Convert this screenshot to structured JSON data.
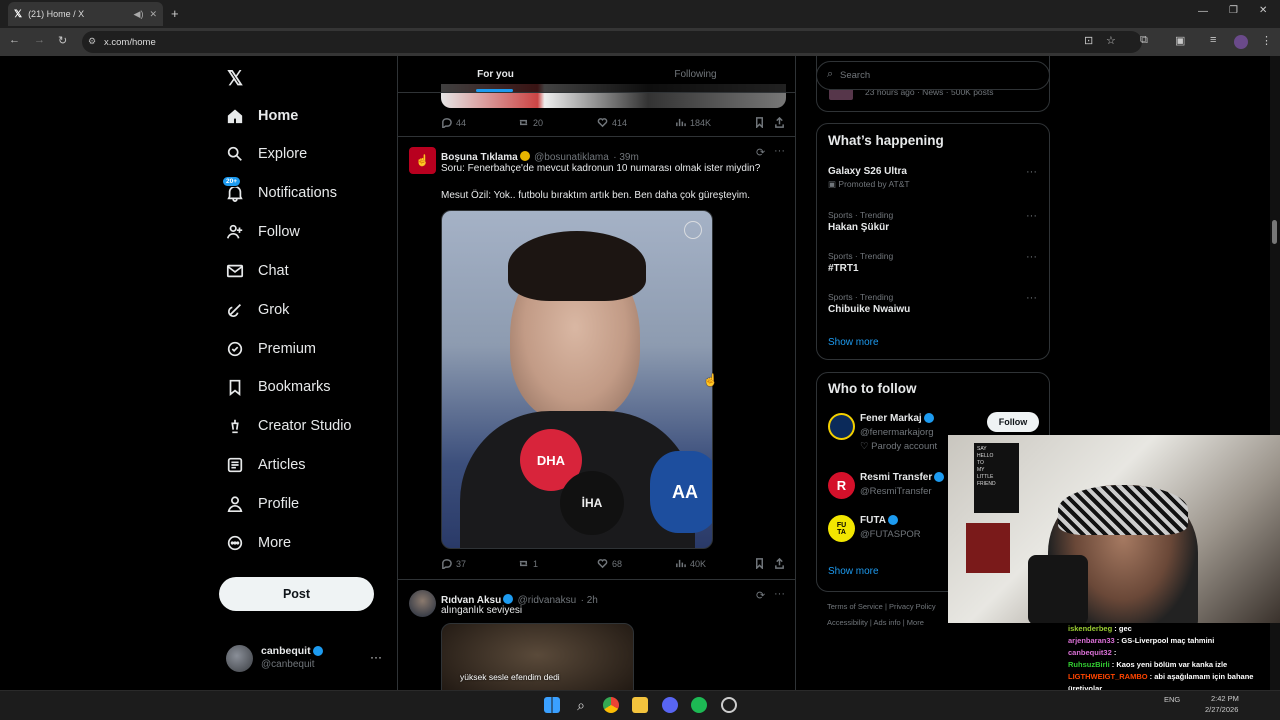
{
  "browser": {
    "tab_title": "(21) Home / X",
    "url": "x.com/home"
  },
  "sidebar": {
    "items": [
      {
        "label": "Home",
        "icon": "home-icon"
      },
      {
        "label": "Explore",
        "icon": "search-icon"
      },
      {
        "label": "Notifications",
        "icon": "bell-icon",
        "badge": "20+"
      },
      {
        "label": "Follow",
        "icon": "person-plus-icon"
      },
      {
        "label": "Chat",
        "icon": "mail-icon"
      },
      {
        "label": "Grok",
        "icon": "grok-icon"
      },
      {
        "label": "Premium",
        "icon": "premium-icon"
      },
      {
        "label": "Bookmarks",
        "icon": "bookmark-icon"
      },
      {
        "label": "Creator Studio",
        "icon": "creator-icon"
      },
      {
        "label": "Articles",
        "icon": "articles-icon"
      },
      {
        "label": "Profile",
        "icon": "profile-icon"
      },
      {
        "label": "More",
        "icon": "more-icon"
      }
    ],
    "post_label": "Post",
    "account": {
      "name": "canbequit",
      "handle": "@canbequit"
    }
  },
  "feed": {
    "tabs": [
      "For you",
      "Following"
    ],
    "top_actions": {
      "replies": "44",
      "reposts": "20",
      "likes": "414",
      "views": "184K"
    },
    "tweets": [
      {
        "name": "Boşuna Tıklama",
        "handle": "@bosunatiklama",
        "time": "· 39m",
        "text1": "Soru: Fenerbahçe'de mevcut kadronun 10 numarası olmak ister miydin?",
        "text2": "Mesut Özil: Yok.. futbolu bıraktım artık ben. Ben daha çok güreşteyim.",
        "replies": "37",
        "reposts": "1",
        "likes": "68",
        "views": "40K"
      },
      {
        "name": "Rıdvan Aksu",
        "handle": "@ridvanaksu",
        "time": "· 2h",
        "text1": "alınganlık seviyesi",
        "caption": "yüksek sesle efendim dedi"
      }
    ]
  },
  "right": {
    "search_placeholder": "Search",
    "top_meta": "23 hours ago · News · 500K posts",
    "whats_happening": {
      "title": "What’s happening",
      "items": [
        {
          "meta": "Promoted by AT&T",
          "name": "Galaxy S26 Ultra"
        },
        {
          "meta": "Sports · Trending",
          "name": "Hakan Şükür"
        },
        {
          "meta": "Sports · Trending",
          "name": "#TRT1"
        },
        {
          "meta": "Sports · Trending",
          "name": "Chibuike Nwaiwu"
        }
      ],
      "show_more": "Show more"
    },
    "who_to_follow": {
      "title": "Who to follow",
      "accounts": [
        {
          "name": "Fener Markaj",
          "handle": "@fenermarkajorg",
          "note": "Parody account",
          "button": "Follow"
        },
        {
          "name": "Resmi Transfer",
          "handle": "@ResmiTransfer"
        },
        {
          "name": "FUTA",
          "handle": "@FUTASPOR"
        }
      ],
      "show_more": "Show more"
    },
    "footer": [
      "Terms of Service",
      "Privacy Policy",
      "Accessibility",
      "Ads info",
      "More"
    ]
  },
  "stream_chat": [
    {
      "user": "iskenderbeg",
      "msg": ": gec",
      "color": "#9acd32"
    },
    {
      "user": "arjenbaran33",
      "msg": ": GS-Liverpool maç tahmini",
      "color": "#da70d6"
    },
    {
      "user": "canbequit32",
      "msg": ":",
      "color": "#da70d6"
    },
    {
      "user": "RuhsuzBirli",
      "msg": ": Kaos yeni bölüm var kanka izle",
      "color": "#32cd32"
    },
    {
      "user": "LIGTHWEIGT_RAMBO",
      "msg": ": abi aşağılamam için bahane üretiyolar",
      "color": "#ff4500"
    },
    {
      "user": "poyraz5534",
      "msg": ": LLIA KANTE GIBI ABI DIMI",
      "color": "#da70d6"
    }
  ],
  "taskbar": {
    "lang": "ENG",
    "time": "2:42 PM",
    "date": "2/27/2026"
  }
}
